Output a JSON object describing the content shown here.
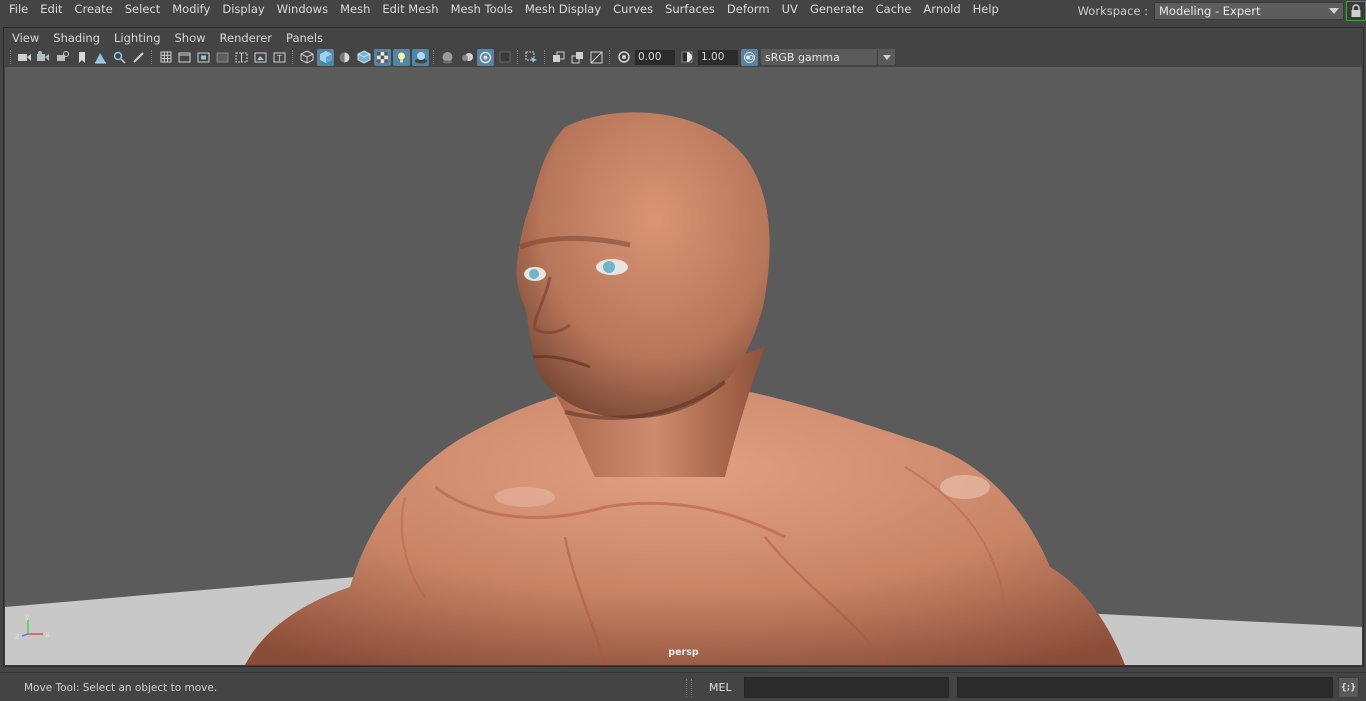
{
  "menubar": {
    "items": [
      "File",
      "Edit",
      "Create",
      "Select",
      "Modify",
      "Display",
      "Windows",
      "Mesh",
      "Edit Mesh",
      "Mesh Tools",
      "Mesh Display",
      "Curves",
      "Surfaces",
      "Deform",
      "UV",
      "Generate",
      "Cache",
      "Arnold",
      "Help"
    ]
  },
  "workspace": {
    "label": "Workspace :",
    "value": "Modeling - Expert",
    "lock_icon": "lock-icon"
  },
  "panel": {
    "menu": [
      "View",
      "Shading",
      "Lighting",
      "Show",
      "Renderer",
      "Panels"
    ],
    "toolbar": {
      "exposure": "0.00",
      "gamma": "1.00",
      "color_space": "sRGB gamma",
      "accent_color": "#5285a6"
    }
  },
  "viewport": {
    "camera_label": "persp",
    "background_color": "#5b5b5b",
    "ground_color": "#c8c8c8",
    "skin_color": "#c98466",
    "axis": {
      "x": "x",
      "y": "y",
      "z": "z"
    }
  },
  "statusbar": {
    "help_line": "Move Tool: Select an object to move.",
    "command_label": "MEL",
    "command_value": "",
    "result_value": "",
    "script_editor_icon": "script-editor-icon",
    "script_editor_glyph": "{;}"
  }
}
